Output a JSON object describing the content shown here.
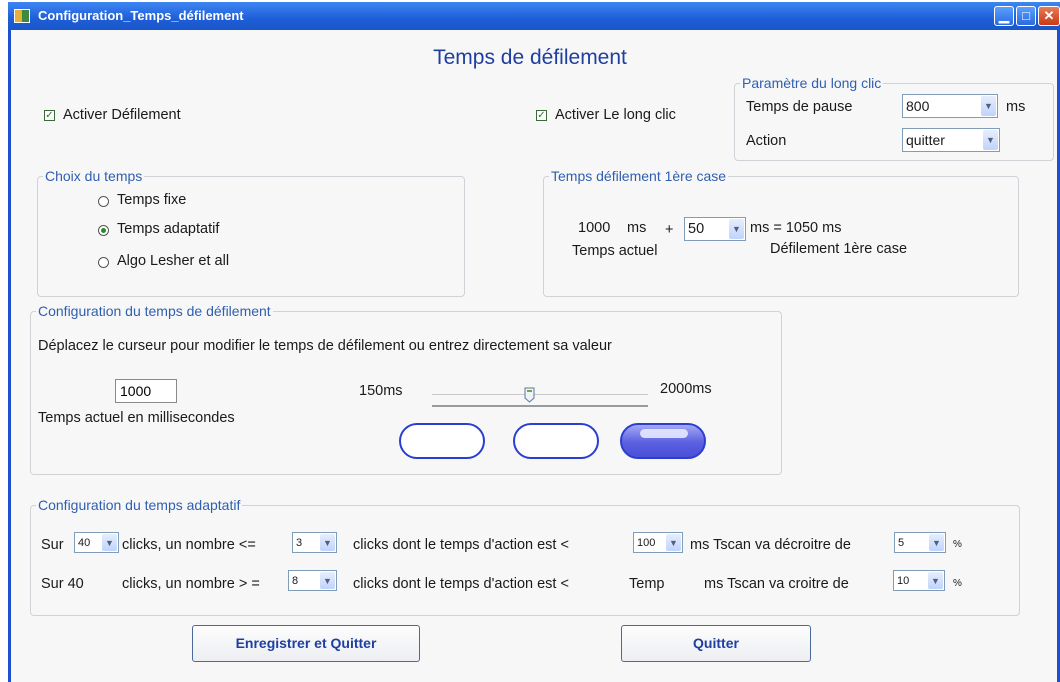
{
  "window": {
    "title": "Configuration_Temps_défilement"
  },
  "heading": "Temps de défilement",
  "activer_defilement": {
    "label": "Activer Défilement",
    "checked": true
  },
  "activer_long_clic": {
    "label": "Activer Le long clic",
    "checked": true
  },
  "long_clic": {
    "legend": "Paramètre du long clic",
    "pause_label": "Temps de pause",
    "pause_value": "800",
    "pause_unit": "ms",
    "action_label": "Action",
    "action_value": "quitter"
  },
  "choix_temps": {
    "legend": "Choix du temps",
    "options": [
      {
        "label": "Temps fixe",
        "selected": false
      },
      {
        "label": "Temps adaptatif",
        "selected": true
      },
      {
        "label": "Algo Lesher et all",
        "selected": false
      }
    ]
  },
  "premiere_case": {
    "legend": "Temps défilement  1ère case",
    "current_value": "1000",
    "unit1": "ms",
    "plus": "+",
    "add_value": "50",
    "result": "ms = 1050  ms",
    "current_label": "Temps actuel",
    "result_label": "Défilement 1ère case"
  },
  "config_defilement": {
    "legend": "Configuration du temps de défilement",
    "instruction": "Déplacez le curseur pour modifier le temps de défilement ou entrez directement sa valeur",
    "value": "1000",
    "value_label": "Temps actuel en millisecondes",
    "slider_min_label": "150ms",
    "slider_max_label": "2000ms",
    "slider_level": 0.45,
    "selected_pill": 3
  },
  "adaptatif": {
    "legend": "Configuration du temps adaptatif",
    "row1": {
      "sur": "Sur",
      "clicks_value": "40",
      "clicks_text": "clicks, un nombre <=",
      "count_value": "3",
      "action_text": "clicks dont le temps d'action est <",
      "time_value": "100",
      "tscan_text": "ms Tscan va décroitre de",
      "percent_value": "5",
      "percent": "%"
    },
    "row2": {
      "sur": "Sur 40",
      "clicks_text": "clicks, un nombre > =",
      "count_value": "8",
      "action_text": "clicks dont le temps d'action est <",
      "temp_text": "Temp",
      "tscan_text": "ms Tscan va croitre de",
      "percent_value": "10",
      "percent": "%"
    }
  },
  "buttons": {
    "save": "Enregistrer et Quitter",
    "quit": "Quitter"
  },
  "colors": {
    "titlebar": "#1e5ed8",
    "legend": "#2f5fb0",
    "heading": "#1f3fa0",
    "pill": "#2a3fd0"
  }
}
